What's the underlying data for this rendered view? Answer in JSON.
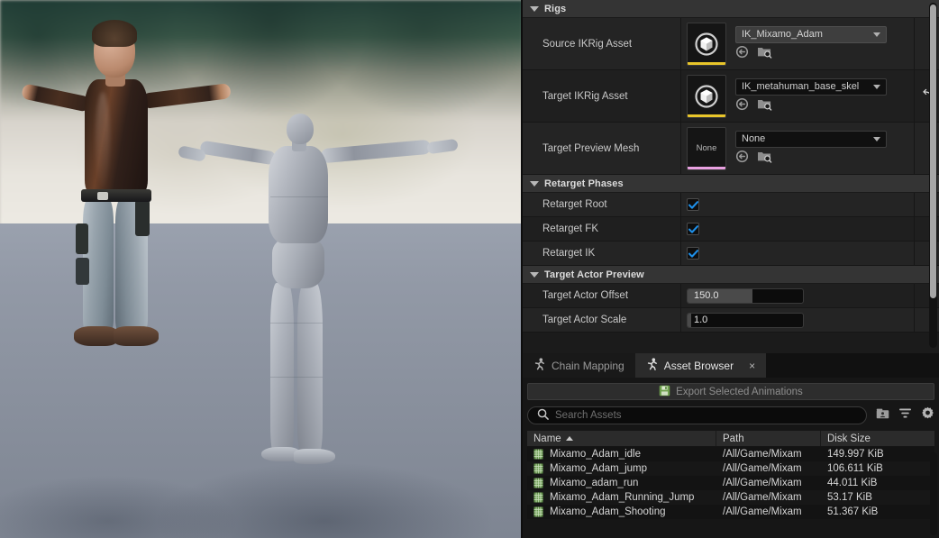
{
  "viewport": {
    "name": "ik-retargeter-viewport",
    "source_character": "Mixamo Adam (source skeletal mesh)",
    "target_character": "Metahuman base skeleton preview mesh"
  },
  "details": {
    "categories": [
      {
        "title": "Rigs",
        "rows": [
          {
            "label": "Source IKRig Asset",
            "thumbnail": "ikrig-cube-icon",
            "thumbnail_bar_color": "#e8c52a",
            "value": "IK_Mixamo_Adam",
            "state": "hover",
            "icons": [
              "browse-to-asset-icon",
              "find-in-content-browser-icon"
            ]
          },
          {
            "label": "Target IKRig Asset",
            "thumbnail": "ikrig-cube-icon",
            "thumbnail_bar_color": "#e8c52a",
            "value": "IK_metahuman_base_skel",
            "state": "normal",
            "icons": [
              "browse-to-asset-icon",
              "find-in-content-browser-icon"
            ],
            "has_reset": true
          },
          {
            "label": "Target Preview Mesh",
            "thumbnail": "None",
            "thumbnail_bar_color": "#e8a0e0",
            "value": "None",
            "state": "normal",
            "icons": [
              "browse-to-asset-icon",
              "find-in-content-browser-icon"
            ]
          }
        ]
      },
      {
        "title": "Retarget Phases",
        "checkboxes": [
          {
            "label": "Retarget Root",
            "checked": true
          },
          {
            "label": "Retarget FK",
            "checked": true
          },
          {
            "label": "Retarget IK",
            "checked": true
          }
        ]
      },
      {
        "title": "Target Actor Preview",
        "spinners": [
          {
            "label": "Target Actor Offset",
            "value": "150.0",
            "fill_pct": 56
          },
          {
            "label": "Target Actor Scale",
            "value": "1.0",
            "fill_pct": 3
          }
        ]
      }
    ],
    "accent_checkbox_color": "#1e8fe8",
    "scrollbar": "details-vertical-scrollbar"
  },
  "bottom": {
    "tabs": [
      {
        "label": "Chain Mapping",
        "icon": "running-person-icon",
        "active": false,
        "closable": false
      },
      {
        "label": "Asset Browser",
        "icon": "running-person-icon",
        "active": true,
        "closable": true,
        "close_label": "×"
      }
    ],
    "export_button": {
      "label": "Export Selected Animations",
      "icon": "save-disk-icon"
    },
    "search": {
      "placeholder": "Search Assets",
      "value": "",
      "icon": "search-icon"
    },
    "toolbar_icons": [
      "collections-icon",
      "filter-icon",
      "settings-gear-icon"
    ],
    "table": {
      "columns": [
        {
          "label": "Name",
          "sorted": "asc"
        },
        {
          "label": "Path",
          "sorted": ""
        },
        {
          "label": "Disk Size",
          "sorted": ""
        }
      ],
      "rows": [
        {
          "icon": "animation-sequence-icon",
          "name": "Mixamo_Adam_idle",
          "path": "/All/Game/Mixam",
          "size": "149.997 KiB"
        },
        {
          "icon": "animation-sequence-icon",
          "name": "Mixamo_Adam_jump",
          "path": "/All/Game/Mixam",
          "size": "106.611 KiB"
        },
        {
          "icon": "animation-sequence-icon",
          "name": "Mixamo_adam_run",
          "path": "/All/Game/Mixam",
          "size": "44.011 KiB"
        },
        {
          "icon": "animation-sequence-icon",
          "name": "Mixamo_Adam_Running_Jump",
          "path": "/All/Game/Mixam",
          "size": "53.17 KiB"
        },
        {
          "icon": "animation-sequence-icon",
          "name": "Mixamo_Adam_Shooting",
          "path": "/All/Game/Mixam",
          "size": "51.367 KiB"
        }
      ]
    }
  }
}
